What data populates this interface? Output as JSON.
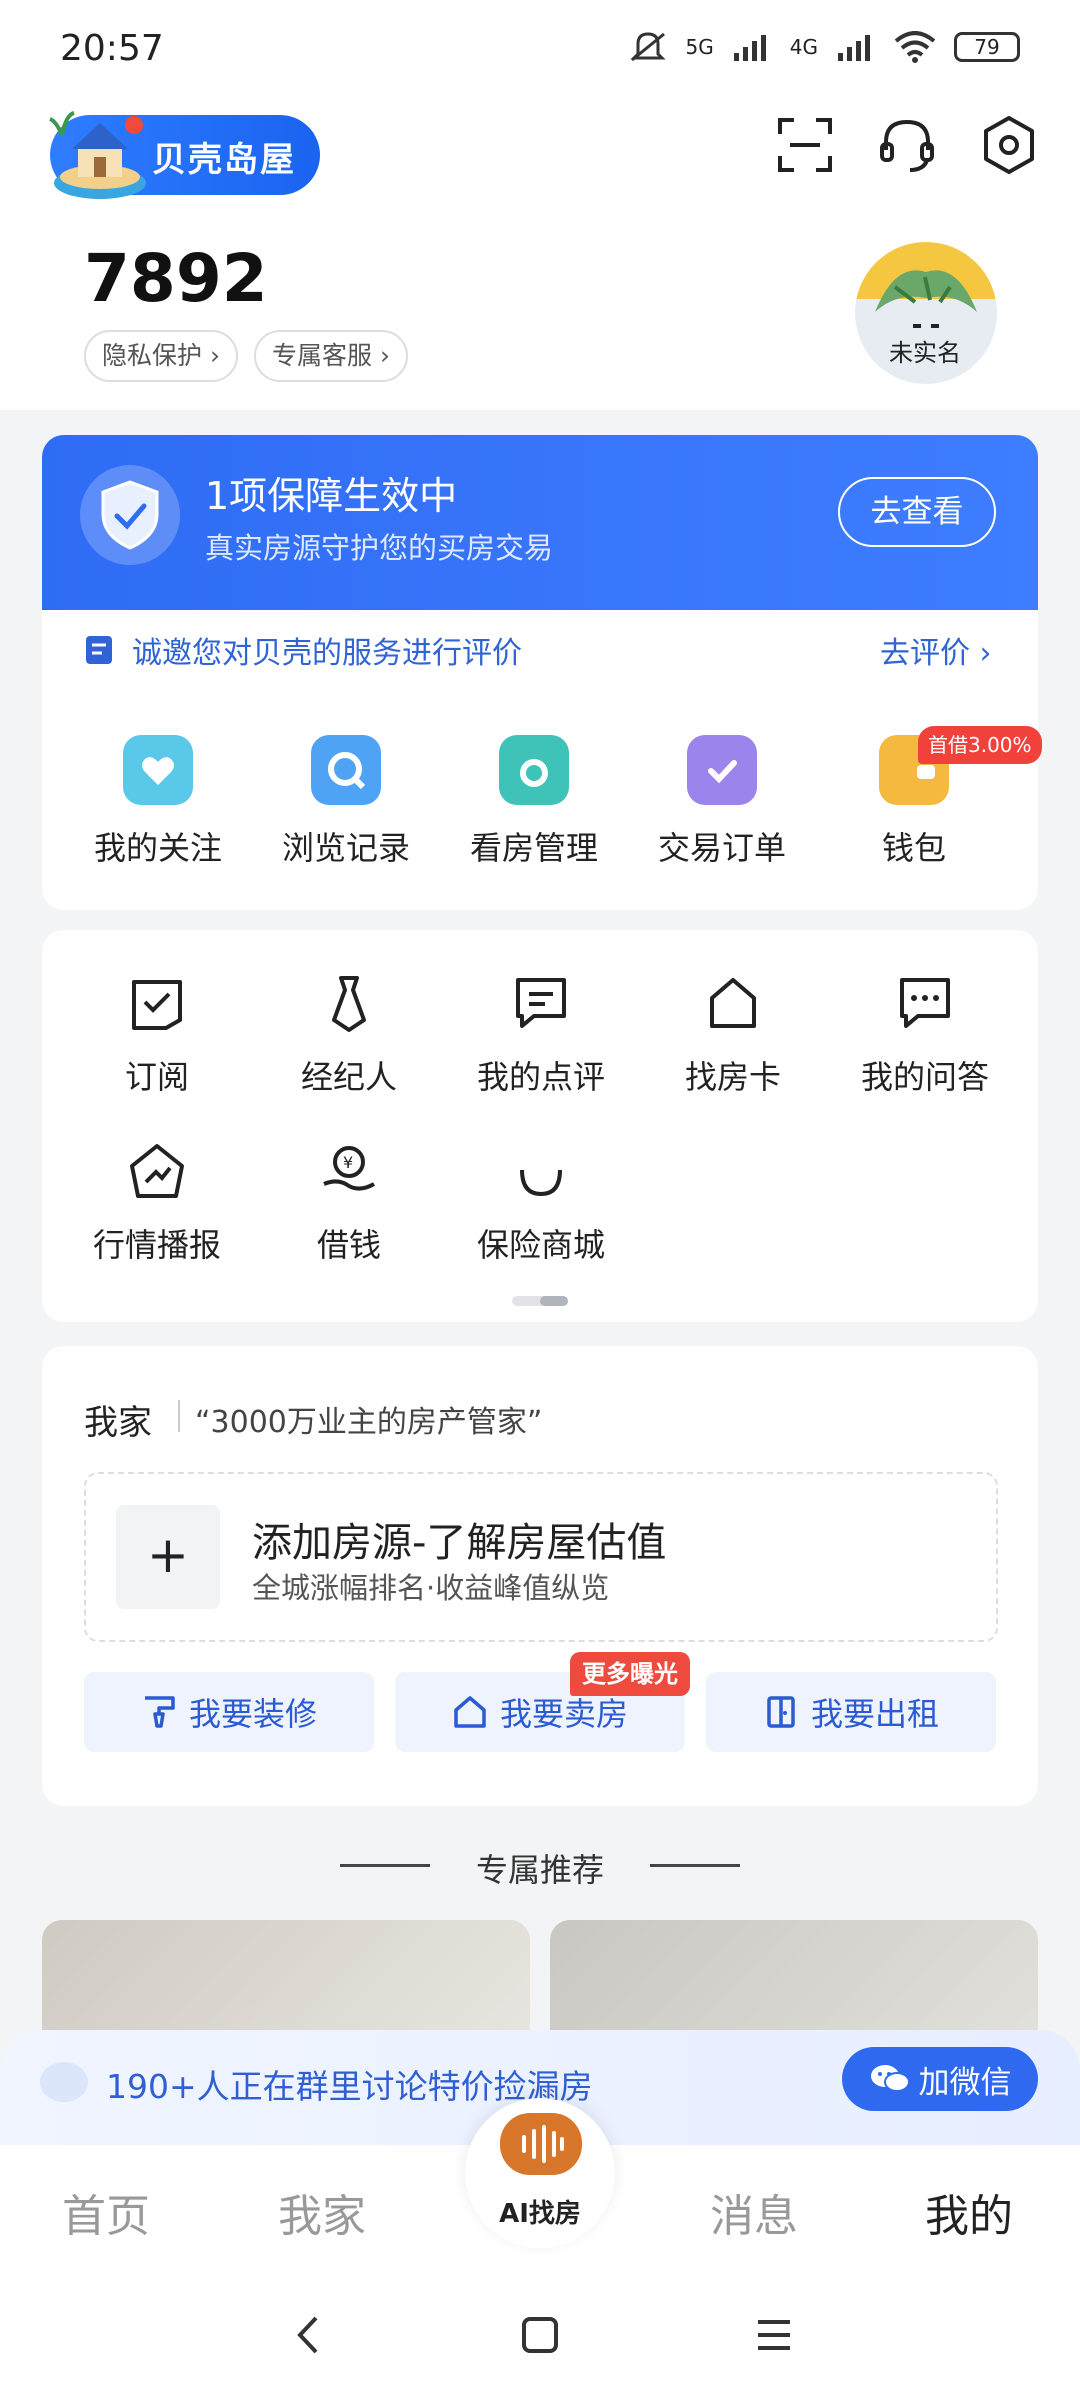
{
  "status_bar": {
    "time": "20:57",
    "network_1": "5G",
    "network_2": "4G",
    "battery": "79"
  },
  "header": {
    "app_name": "贝壳岛屋",
    "user_id": "7892",
    "chips": [
      "隐私保护",
      "专属客服"
    ],
    "avatar_label": "未实名"
  },
  "protection": {
    "title": "1项保障生效中",
    "subtitle": "真实房源守护您的买房交易",
    "button": "去查看"
  },
  "evaluation": {
    "text": "诚邀您对贝壳的服务进行评价",
    "link": "去评价"
  },
  "quick_actions": [
    {
      "label": "我的关注",
      "icon": "heart-house-icon",
      "color": "#5ac8e8"
    },
    {
      "label": "浏览记录",
      "icon": "browse-icon",
      "color": "#4ea3f4"
    },
    {
      "label": "看房管理",
      "icon": "folder-icon",
      "color": "#3fc3b8"
    },
    {
      "label": "交易订单",
      "icon": "clipboard-check-icon",
      "color": "#9b84ec"
    },
    {
      "label": "钱包",
      "icon": "wallet-icon",
      "color": "#f5b93f"
    }
  ],
  "wallet_badge": "首借3.00%",
  "services": [
    {
      "label": "订阅",
      "icon": "subscribe-icon"
    },
    {
      "label": "经纪人",
      "icon": "agent-icon"
    },
    {
      "label": "我的点评",
      "icon": "comment-icon"
    },
    {
      "label": "找房卡",
      "icon": "house-card-icon"
    },
    {
      "label": "我的问答",
      "icon": "qa-icon"
    },
    {
      "label": "行情播报",
      "icon": "market-icon"
    },
    {
      "label": "借钱",
      "icon": "loan-icon"
    },
    {
      "label": "保险商城",
      "icon": "insurance-icon"
    }
  ],
  "my_home": {
    "title": "我家",
    "quote": "“3000万业主的房产管家”",
    "add_title": "添加房源-了解房屋估值",
    "add_subtitle": "全城涨幅排名·收益峰值纵览",
    "actions": [
      "我要装修",
      "我要卖房",
      "我要出租"
    ],
    "sell_tag": "更多曝光"
  },
  "recommend": {
    "title": "专属推荐"
  },
  "group_banner": {
    "text": "190+人正在群里讨论特价捡漏房",
    "button": "加微信"
  },
  "tabbar": {
    "tabs": [
      "首页",
      "我家",
      "AI找房",
      "消息",
      "我的"
    ],
    "active": "我的"
  }
}
